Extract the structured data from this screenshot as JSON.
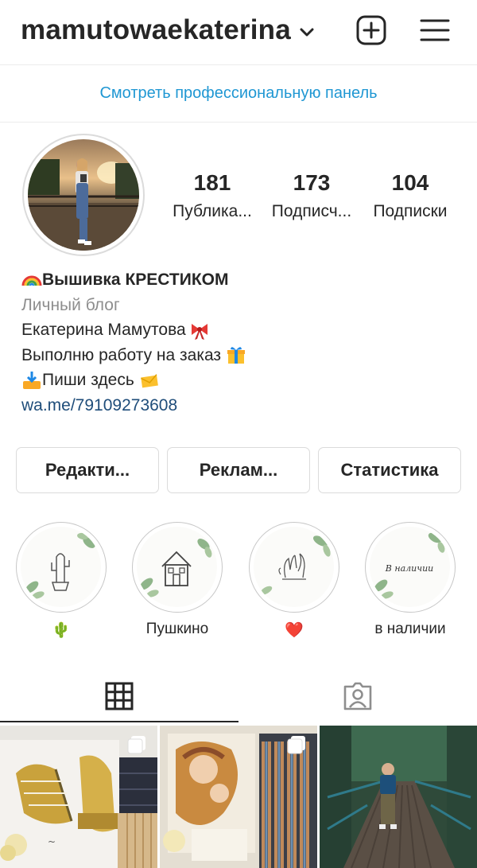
{
  "header": {
    "username": "mamutowaekaterina",
    "icons": [
      "chevron-down-icon",
      "new-post-icon",
      "menu-icon"
    ]
  },
  "pro_dashboard": {
    "label": "Смотреть профессиональную панель"
  },
  "stats": [
    {
      "value": "181",
      "label": "Публика..."
    },
    {
      "value": "173",
      "label": "Подписч..."
    },
    {
      "value": "104",
      "label": "Подписки"
    }
  ],
  "bio": {
    "name": "Вышивка КРЕСТИКОМ",
    "category": "Личный блог",
    "line1": "Екатерина Мамутова",
    "line2": "Выполню работу на заказ",
    "line3": "Пиши здесь",
    "link": "wa.me/79109273608",
    "emojis": [
      "rainbow",
      "ribbon",
      "gift",
      "inbox-tray",
      "envelope"
    ]
  },
  "buttons": {
    "edit": "Редакти...",
    "promo": "Реклам...",
    "stats": "Статистика"
  },
  "highlights": [
    {
      "label": "🌵",
      "icon": "cactus"
    },
    {
      "label": "Пушкино",
      "icon": "house"
    },
    {
      "label": "❤️",
      "icon": "hands"
    },
    {
      "label": "в наличии",
      "icon": "text",
      "cover_text": "В наличии"
    }
  ],
  "tabs": [
    {
      "name": "grid",
      "active": true
    },
    {
      "name": "tagged",
      "active": false
    }
  ],
  "colors": {
    "link_blue": "#1f97d3",
    "bio_link": "#1f4d7a",
    "text": "#262626",
    "muted": "#8e8e8e",
    "border": "#dbdbdb"
  }
}
